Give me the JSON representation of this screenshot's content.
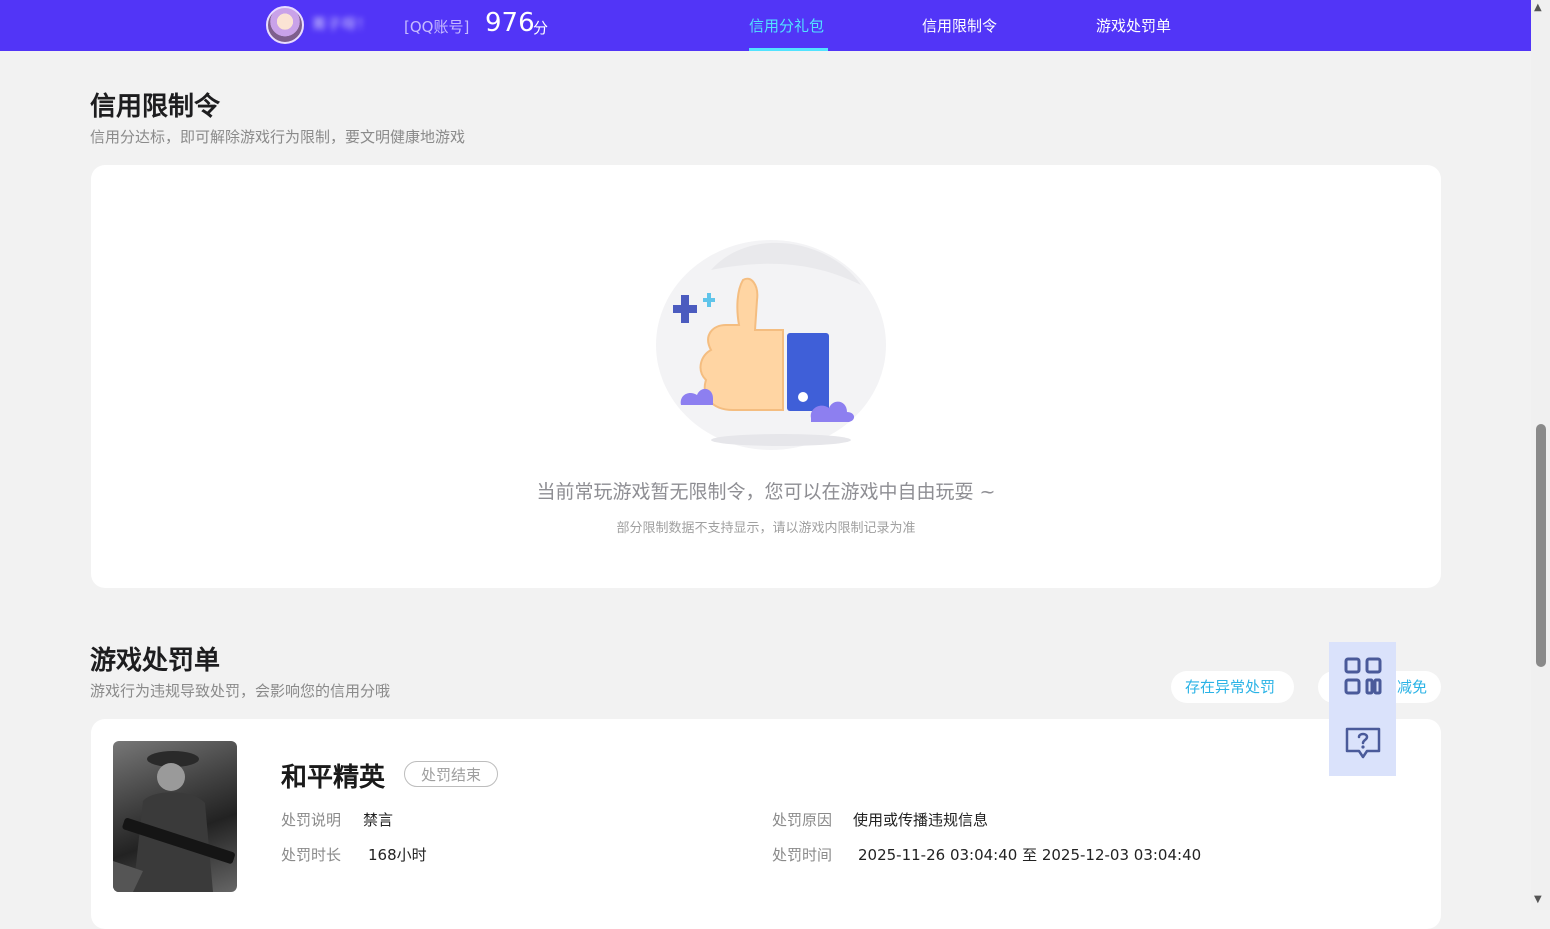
{
  "header": {
    "username": "菁子呀！",
    "account_type": "[QQ账号]",
    "score": "976",
    "score_unit": "分",
    "nav_tabs": [
      {
        "label": "信用分礼包",
        "active": true
      },
      {
        "label": "信用限制令",
        "active": false
      },
      {
        "label": "游戏处罚单",
        "active": false
      }
    ]
  },
  "restriction_section": {
    "title": "信用限制令",
    "subtitle": "信用分达标，即可解除游戏行为限制，要文明健康地游戏",
    "empty_message": "当前常玩游戏暂无限制令，您可以在游戏中自由玩耍 ~",
    "empty_note": "部分限制数据不支持显示，请以游戏内限制记录为准"
  },
  "penalty_section": {
    "title": "游戏处罚单",
    "subtitle": "游戏行为违规导致处罚，会影响您的信用分哦",
    "actions": {
      "appeal": "存在异常处罚",
      "reduce": "减免"
    },
    "record": {
      "game_name": "和平精英",
      "status": "处罚结束",
      "desc_label": "处罚说明",
      "desc_value": "禁言",
      "reason_label": "处罚原因",
      "reason_value": "使用或传播违规信息",
      "duration_label": "处罚时长",
      "duration_value": "168小时",
      "time_label": "处罚时间",
      "time_value": "2025-11-26 03:04:40 至 2025-12-03 03:04:40"
    }
  },
  "floating": {
    "items": [
      "qrcode-icon",
      "help-icon"
    ]
  },
  "colors": {
    "header_bg": "#5235f7",
    "active_tab": "#52e3ff",
    "link": "#2bb3e6",
    "page_bg": "#f2f2f2"
  }
}
